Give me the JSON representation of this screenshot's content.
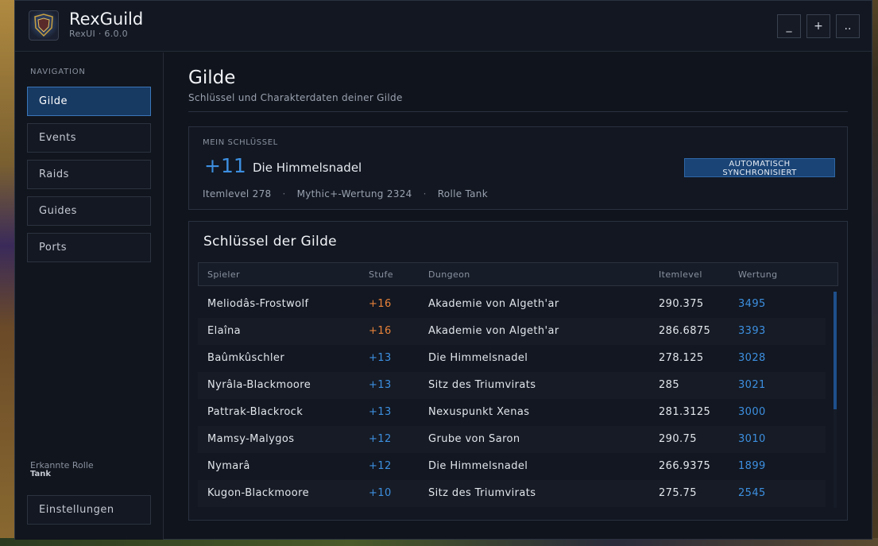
{
  "app": {
    "title": "RexGuild",
    "subtitle": "RexUI · 6.0.0",
    "logo_text": "REXGUILD"
  },
  "window_controls": {
    "minimize": "_",
    "expand": "+",
    "more": ".."
  },
  "sidebar": {
    "heading": "NAVIGATION",
    "items": [
      {
        "label": "Gilde",
        "active": true
      },
      {
        "label": "Events",
        "active": false
      },
      {
        "label": "Raids",
        "active": false
      },
      {
        "label": "Guides",
        "active": false
      },
      {
        "label": "Ports",
        "active": false
      }
    ],
    "role_label": "Erkannte Rolle",
    "role_value": "Tank",
    "settings_label": "Einstellungen"
  },
  "page": {
    "title": "Gilde",
    "subtitle": "Schlüssel und Charakterdaten deiner Gilde"
  },
  "my_key": {
    "label": "MEIN SCHLÜSSEL",
    "level": "+11",
    "dungeon": "Die Himmelsnadel",
    "itemlevel": "Itemlevel 278",
    "rating": "Mythic+-Wertung 2324",
    "role": "Rolle Tank",
    "separator": "·",
    "sync_line1": "AUTOMATISCH",
    "sync_line2": "SYNCHRONISIERT"
  },
  "guild_keys": {
    "title": "Schlüssel der Gilde",
    "columns": {
      "player": "Spieler",
      "level": "Stufe",
      "dungeon": "Dungeon",
      "itemlevel": "Itemlevel",
      "rating": "Wertung"
    },
    "rows": [
      {
        "player": "Meliodâs-Frostwolf",
        "level": "+16",
        "dungeon": "Akademie von Algeth'ar",
        "itemlevel": "290.375",
        "rating": "3495"
      },
      {
        "player": "Elaîna",
        "level": "+16",
        "dungeon": "Akademie von Algeth'ar",
        "itemlevel": "286.6875",
        "rating": "3393"
      },
      {
        "player": "Baûmkûschler",
        "level": "+13",
        "dungeon": "Die Himmelsnadel",
        "itemlevel": "278.125",
        "rating": "3028"
      },
      {
        "player": "Nyrâla-Blackmoore",
        "level": "+13",
        "dungeon": "Sitz des Triumvirats",
        "itemlevel": "285",
        "rating": "3021"
      },
      {
        "player": "Pattrak-Blackrock",
        "level": "+13",
        "dungeon": "Nexuspunkt Xenas",
        "itemlevel": "281.3125",
        "rating": "3000"
      },
      {
        "player": "Mamsy-Malygos",
        "level": "+12",
        "dungeon": "Grube von Saron",
        "itemlevel": "290.75",
        "rating": "3010"
      },
      {
        "player": "Nymarâ",
        "level": "+12",
        "dungeon": "Die Himmelsnadel",
        "itemlevel": "266.9375",
        "rating": "1899"
      },
      {
        "player": "Kugon-Blackmoore",
        "level": "+10",
        "dungeon": "Sitz des Triumvirats",
        "itemlevel": "275.75",
        "rating": "2545"
      }
    ]
  },
  "colors": {
    "accent_blue": "#3d8fe0",
    "high_key_orange": "#e8823a",
    "normal_key_blue": "#3d8fe0",
    "active_nav": "#173a63"
  },
  "icons": {
    "logo": "guild-crest-icon"
  }
}
